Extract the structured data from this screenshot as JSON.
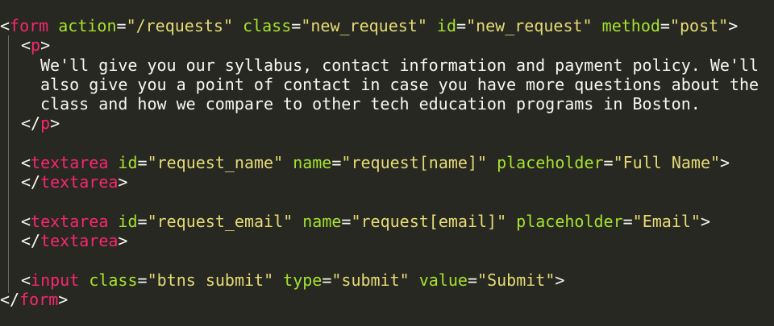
{
  "code": {
    "form_open": {
      "tag": "form",
      "attrs": [
        {
          "name": "action",
          "value": "\"/requests\""
        },
        {
          "name": "class",
          "value": "\"new_request\""
        },
        {
          "name": "id",
          "value": "\"new_request\""
        },
        {
          "name": "method",
          "value": "\"post\""
        }
      ]
    },
    "p_tag": "p",
    "paragraph_lines": [
      "We'll give you our syllabus, contact information and payment policy. We'll",
      "also give you a point of contact in case you have more questions about the",
      "class and how we compare to other tech education programs in Boston."
    ],
    "textarea_name": {
      "tag": "textarea",
      "attrs": [
        {
          "name": "id",
          "value": "\"request_name\""
        },
        {
          "name": "name",
          "value": "\"request[name]\""
        },
        {
          "name": "placeholder",
          "value": "\"Full Name\""
        }
      ]
    },
    "textarea_email": {
      "tag": "textarea",
      "attrs": [
        {
          "name": "id",
          "value": "\"request_email\""
        },
        {
          "name": "name",
          "value": "\"request[email]\""
        },
        {
          "name": "placeholder",
          "value": "\"Email\""
        }
      ]
    },
    "input_submit": {
      "tag": "input",
      "attrs": [
        {
          "name": "class",
          "value": "\"btns submit\""
        },
        {
          "name": "type",
          "value": "\"submit\""
        },
        {
          "name": "value",
          "value": "\"Submit\""
        }
      ]
    },
    "form_close_tag": "form",
    "textarea_close_tag": "textarea"
  },
  "colors": {
    "background": "#272822",
    "tag": "#f92672",
    "attribute": "#a6e22e",
    "string": "#e6db74",
    "text": "#f8f8f2",
    "indent_guide": "#6b6b62"
  }
}
